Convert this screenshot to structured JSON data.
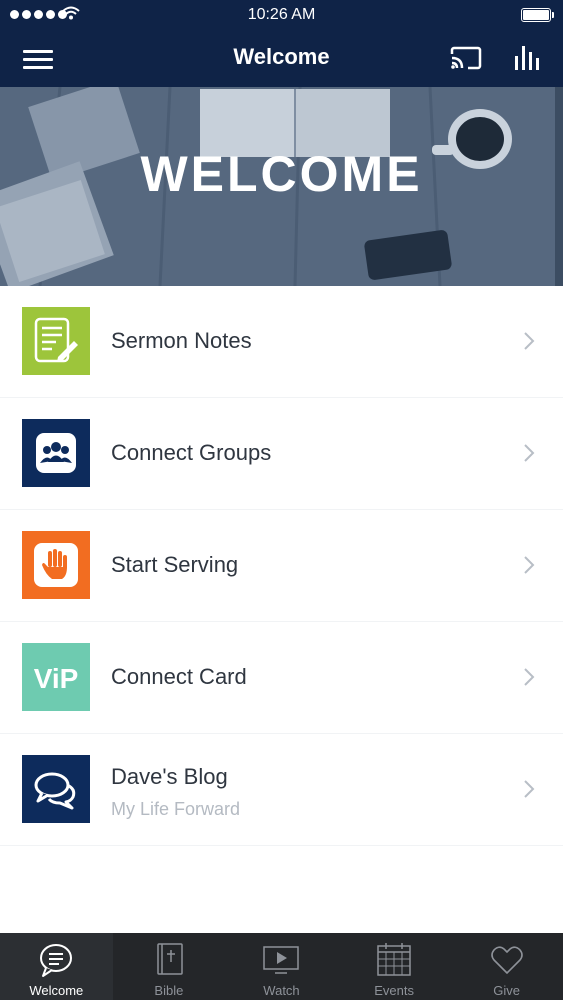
{
  "status_bar": {
    "time": "10:26 AM"
  },
  "nav": {
    "title": "Welcome"
  },
  "hero": {
    "title": "WELCOME"
  },
  "menu_items": [
    {
      "label": "Sermon Notes",
      "icon": "sermon-notes-icon",
      "color": "#9dc53b"
    },
    {
      "label": "Connect Groups",
      "icon": "groups-icon",
      "color": "#0d2b5c"
    },
    {
      "label": "Start Serving",
      "icon": "hand-icon",
      "color": "#f26d21"
    },
    {
      "label": "Connect Card",
      "icon": "vip-icon",
      "icon_text": "ViP",
      "color": "#6ecbb0"
    },
    {
      "label": "Dave's Blog",
      "subtitle": "My Life Forward",
      "icon": "chat-bubbles-icon",
      "color": "#0d2b5c"
    }
  ],
  "tabs": [
    {
      "label": "Welcome",
      "icon": "chat-icon",
      "active": true
    },
    {
      "label": "Bible",
      "icon": "bible-icon"
    },
    {
      "label": "Watch",
      "icon": "play-icon"
    },
    {
      "label": "Events",
      "icon": "calendar-icon"
    },
    {
      "label": "Give",
      "icon": "heart-icon"
    }
  ],
  "colors": {
    "header_bg": "#0f2347",
    "tabbar_bg": "#242629"
  }
}
